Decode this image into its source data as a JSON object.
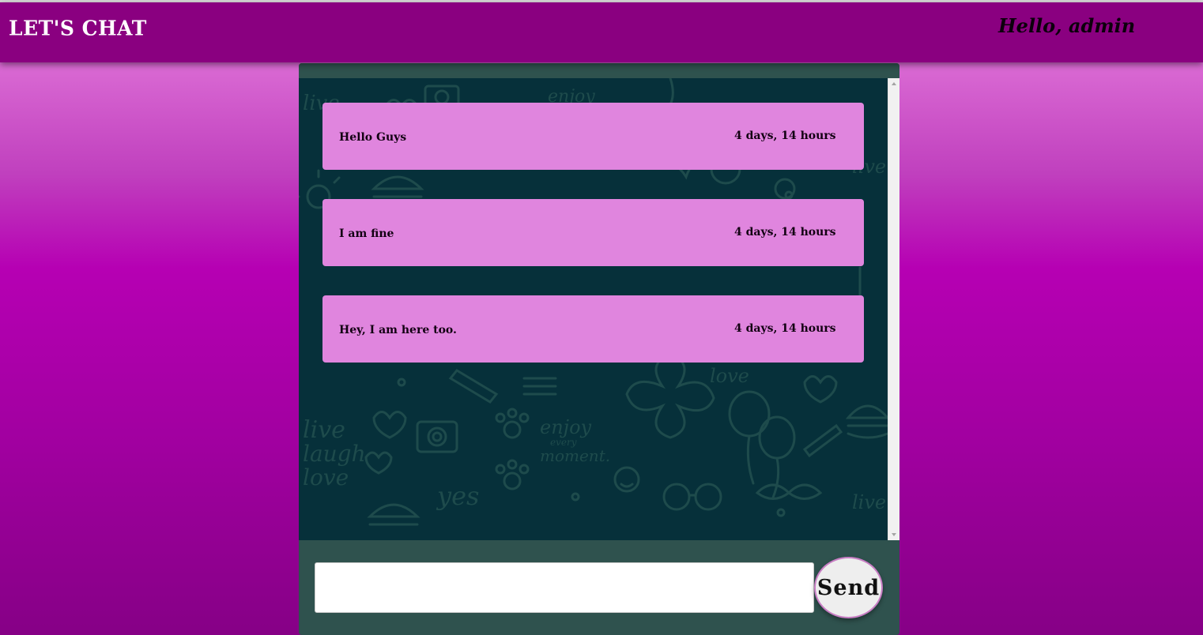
{
  "header": {
    "brand": "LET'S CHAT",
    "greeting": "Hello, admin"
  },
  "messages": [
    {
      "text": "Hello Guys",
      "time": "4 days, 14 hours"
    },
    {
      "text": "I am fine",
      "time": "4 days, 14 hours"
    },
    {
      "text": "Hey, I am here too.",
      "time": "4 days, 14 hours"
    }
  ],
  "composer": {
    "input_value": "",
    "input_placeholder": "",
    "send_label": "Send"
  },
  "colors": {
    "header": "#8a0080",
    "bubble": "#e085de",
    "chat_wallpaper": "#06303a",
    "panel": "#2f524e"
  },
  "wallpaper_words": [
    "live",
    "laugh",
    "love",
    "enjoy",
    "every",
    "moment.",
    "yes"
  ]
}
